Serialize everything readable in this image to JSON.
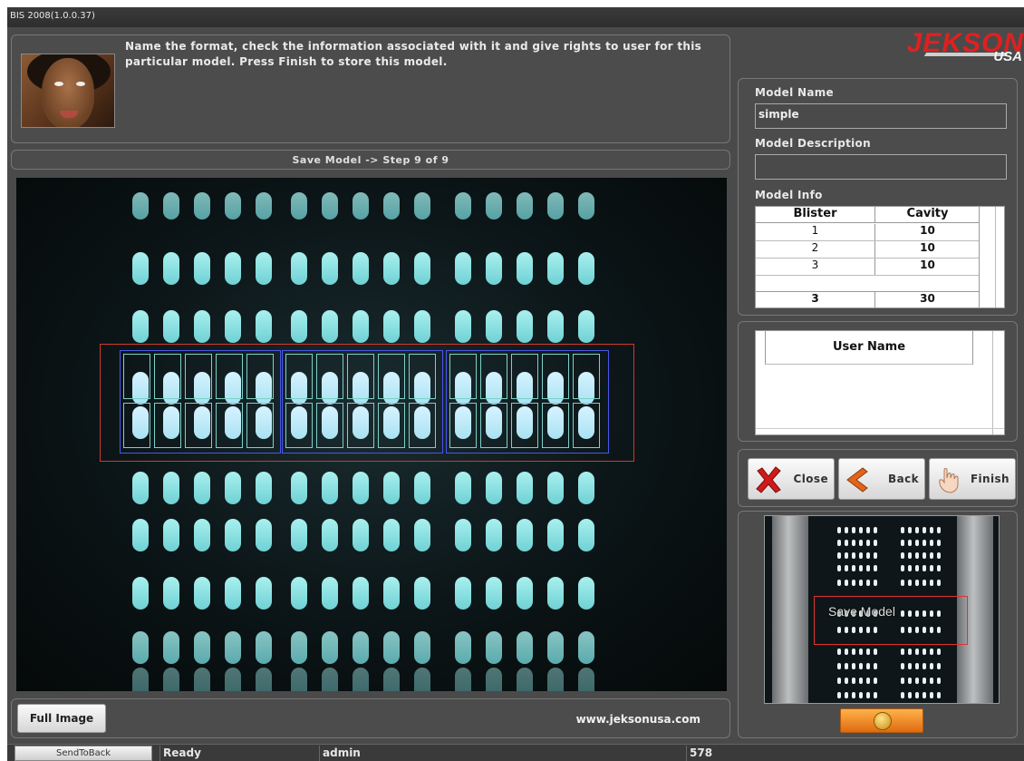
{
  "window": {
    "title": "BIS 2008(1.0.0.37)"
  },
  "instructions": {
    "text": "Name the format, check the information associated with it and give rights to user for this particular model. Press Finish to store this model."
  },
  "step": {
    "label": "Save Model -> Step 9 of 9"
  },
  "logo": {
    "brand": "JEKSON",
    "suffix": "USA"
  },
  "model": {
    "name_label": "Model Name",
    "name_value": "simple",
    "description_label": "Model Description",
    "description_value": "",
    "info_label": "Model Info",
    "columns": [
      "Blister",
      "Cavity"
    ],
    "rows": [
      {
        "blister": "1",
        "cavity": "10"
      },
      {
        "blister": "2",
        "cavity": "10"
      },
      {
        "blister": "3",
        "cavity": "10"
      }
    ],
    "total": {
      "blister": "3",
      "cavity": "30"
    }
  },
  "users": {
    "column": "User Name"
  },
  "nav": {
    "close": "Close",
    "back": "Back",
    "finish": "Finish"
  },
  "thumbnail": {
    "overlay_label": "Save Model"
  },
  "bottom": {
    "full_image": "Full Image",
    "website": "www.jeksonusa.com"
  },
  "statusbar": {
    "send_to_back": "SendToBack",
    "status": "Ready",
    "user": "admin",
    "value": "578"
  },
  "colors": {
    "background": "#4a4a4a",
    "accent_red": "#e02020",
    "pill": "#8fe2e3",
    "roi": "#d23a2a",
    "blister_box": "#4b57e8"
  }
}
